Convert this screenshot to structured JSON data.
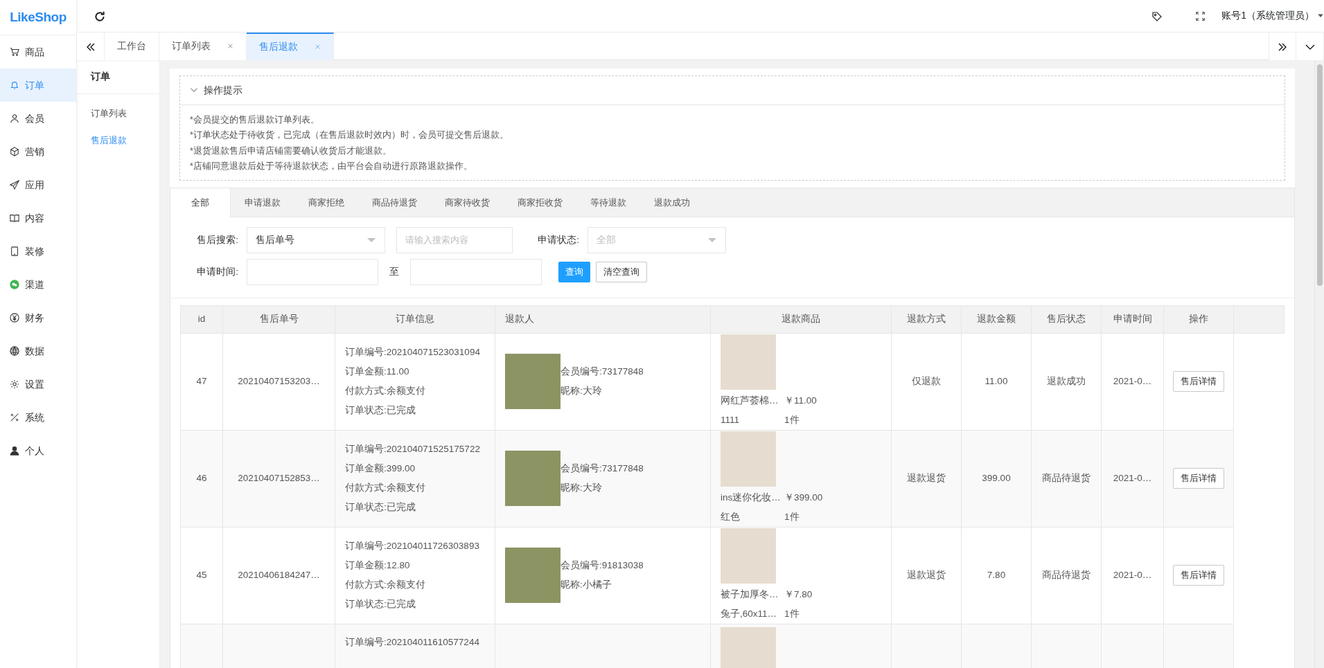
{
  "logo": "LikeShop",
  "sidebar": {
    "items": [
      {
        "label": "商品",
        "selected": false
      },
      {
        "label": "订单",
        "selected": true
      },
      {
        "label": "会员",
        "selected": false
      },
      {
        "label": "营销",
        "selected": false
      },
      {
        "label": "应用",
        "selected": false
      },
      {
        "label": "内容",
        "selected": false
      },
      {
        "label": "装修",
        "selected": false
      },
      {
        "label": "渠道",
        "selected": false
      },
      {
        "label": "财务",
        "selected": false
      },
      {
        "label": "数据",
        "selected": false
      },
      {
        "label": "设置",
        "selected": false
      },
      {
        "label": "系统",
        "selected": false
      },
      {
        "label": "个人",
        "selected": false
      }
    ]
  },
  "header": {
    "account": "账号1（系统管理员）"
  },
  "page_tabs": [
    {
      "label": "工作台",
      "closable": false,
      "selected": false
    },
    {
      "label": "订单列表",
      "closable": true,
      "selected": false
    },
    {
      "label": "售后退款",
      "closable": true,
      "selected": true
    }
  ],
  "subnav": {
    "title": "订单",
    "items": [
      {
        "label": "订单列表",
        "selected": false
      },
      {
        "label": "售后退款",
        "selected": true
      }
    ]
  },
  "notice": {
    "title": "操作提示",
    "expanded": true,
    "lines": [
      "*会员提交的售后退款订单列表。",
      "*订单状态处于待收货，已完成（在售后退款时效内）时，会员可提交售后退款。",
      "*退货退款售后申请店铺需要确认收货后才能退款。",
      "*店铺同意退款后处于等待退款状态，由平台会自动进行原路退款操作。"
    ]
  },
  "status_tabs": [
    {
      "label": "全部",
      "selected": true
    },
    {
      "label": "申请退款",
      "selected": false
    },
    {
      "label": "商家拒绝",
      "selected": false
    },
    {
      "label": "商品待退货",
      "selected": false
    },
    {
      "label": "商家待收货",
      "selected": false
    },
    {
      "label": "商家拒收货",
      "selected": false
    },
    {
      "label": "等待退款",
      "selected": false
    },
    {
      "label": "退款成功",
      "selected": false
    }
  ],
  "search": {
    "type_label": "售后搜索:",
    "type_value": "售后单号",
    "keyword_placeholder": "请输入搜索内容",
    "status_label": "申请状态:",
    "status_placeholder": "全部",
    "time_label": "申请时间:",
    "time_separator": "至",
    "query_button": "查询",
    "reset_button": "清空查询"
  },
  "table": {
    "columns": [
      "id",
      "售后单号",
      "订单信息",
      "退款人",
      "退款商品",
      "退款方式",
      "退款金额",
      "售后状态",
      "申请时间",
      "操作"
    ],
    "rows": [
      {
        "id": "47",
        "refund_sn": "20210407153203…",
        "order_info": [
          "订单编号:202104071523031094",
          "订单金额:11.00",
          "付款方式:余额支付",
          "订单状态:已完成"
        ],
        "member_no": "会员编号:73177848",
        "nickname": "昵称:大玲",
        "goods_name": "网红芦荟棉…",
        "goods_price": "￥11.00",
        "goods_spec": "1111",
        "goods_qty": "1件",
        "refund_way": "仅退款",
        "refund_amount": "11.00",
        "status": "退款成功",
        "apply_time": "2021-0…",
        "action": "售后详情"
      },
      {
        "id": "46",
        "refund_sn": "20210407152853…",
        "order_info": [
          "订单编号:202104071525175722",
          "订单金额:399.00",
          "付款方式:余额支付",
          "订单状态:已完成"
        ],
        "member_no": "会员编号:73177848",
        "nickname": "昵称:大玲",
        "goods_name": "ins迷你化妆…",
        "goods_price": "￥399.00",
        "goods_spec": "红色",
        "goods_qty": "1件",
        "refund_way": "退款退货",
        "refund_amount": "399.00",
        "status": "商品待退货",
        "apply_time": "2021-0…",
        "action": "售后详情"
      },
      {
        "id": "45",
        "refund_sn": "20210406184247…",
        "order_info": [
          "订单编号:202104011726303893",
          "订单金额:12.80",
          "付款方式:余额支付",
          "订单状态:已完成"
        ],
        "member_no": "会员编号:91813038",
        "nickname": "昵称:小橘子",
        "goods_name": "被子加厚冬…",
        "goods_price": "￥7.80",
        "goods_spec": "兔子,60x11…",
        "goods_qty": "1件",
        "refund_way": "退款退货",
        "refund_amount": "7.80",
        "status": "商品待退货",
        "apply_time": "2021-0…",
        "action": "售后详情"
      },
      {
        "order_info": [
          "订单编号:202104011610577244"
        ]
      }
    ]
  }
}
